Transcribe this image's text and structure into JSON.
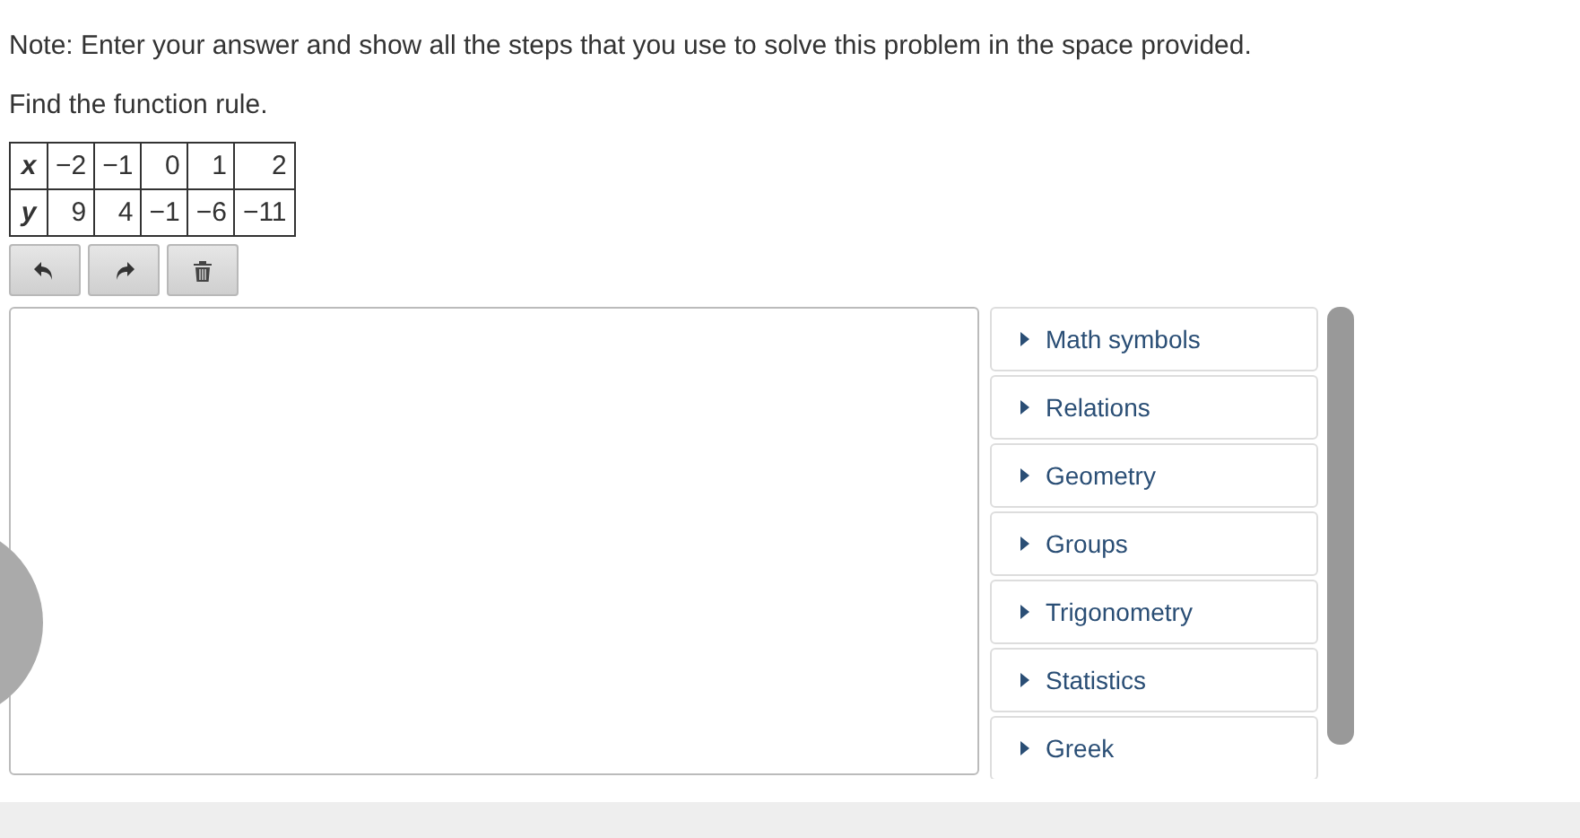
{
  "note": "Note: Enter your answer and show all the steps that you use to solve this problem in the space provided.",
  "question": "Find the function rule.",
  "table": {
    "rows": [
      {
        "label": "x",
        "cells": [
          "−2",
          "−1",
          "0",
          "1",
          "2"
        ]
      },
      {
        "label": "y",
        "cells": [
          "9",
          "4",
          "−1",
          "−6",
          "−11"
        ]
      }
    ]
  },
  "toolbar": [
    {
      "kind": "undo"
    },
    {
      "kind": "redo"
    },
    {
      "kind": "delete"
    }
  ],
  "palette": [
    {
      "label": "Math symbols",
      "expanded": false
    },
    {
      "label": "Relations",
      "expanded": false
    },
    {
      "label": "Geometry",
      "expanded": false
    },
    {
      "label": "Groups",
      "expanded": false
    },
    {
      "label": "Trigonometry",
      "expanded": false
    },
    {
      "label": "Statistics",
      "expanded": false
    },
    {
      "label": "Greek",
      "expanded": false
    }
  ]
}
